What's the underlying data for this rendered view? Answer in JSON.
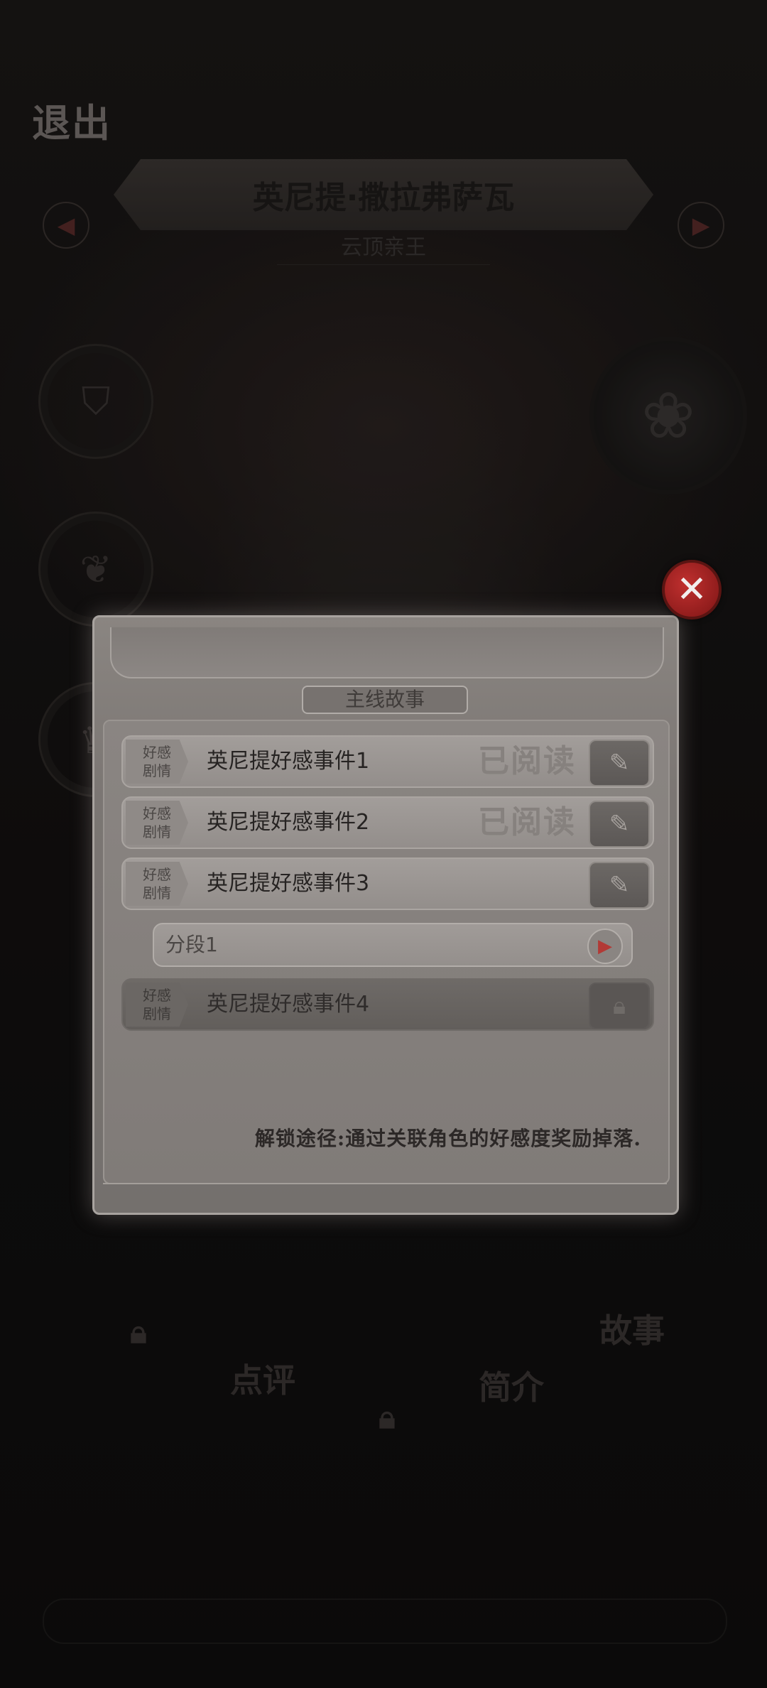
{
  "header": {
    "exit_label": "退出",
    "character_name": "英尼提·撒拉弗萨瓦",
    "character_title": "云顶亲王"
  },
  "bottom_menu": {
    "items": [
      "点评",
      "简介",
      "故事"
    ]
  },
  "modal": {
    "section_title": "主线故事",
    "rows": [
      {
        "tag_line1": "好感",
        "tag_line2": "剧情",
        "title": "英尼提好感事件1",
        "status": "已阅读"
      },
      {
        "tag_line1": "好感",
        "tag_line2": "剧情",
        "title": "英尼提好感事件2",
        "status": "已阅读"
      },
      {
        "tag_line1": "好感",
        "tag_line2": "剧情",
        "title": "英尼提好感事件3"
      },
      {
        "tag_line1": "好感",
        "tag_line2": "剧情",
        "title": "英尼提好感事件4",
        "locked": true
      }
    ],
    "segment_label": "分段1",
    "unlock_hint": "解锁途径:通过关联角色的好感度奖励掉落."
  },
  "icons": {
    "close": "close-icon",
    "edit": "edit-pencil-icon",
    "lock": "lock-icon",
    "play": "play-icon"
  },
  "colors": {
    "close_button": "#b02a2a",
    "play_icon": "#b23a36",
    "modal_bg": "#7b7673"
  }
}
